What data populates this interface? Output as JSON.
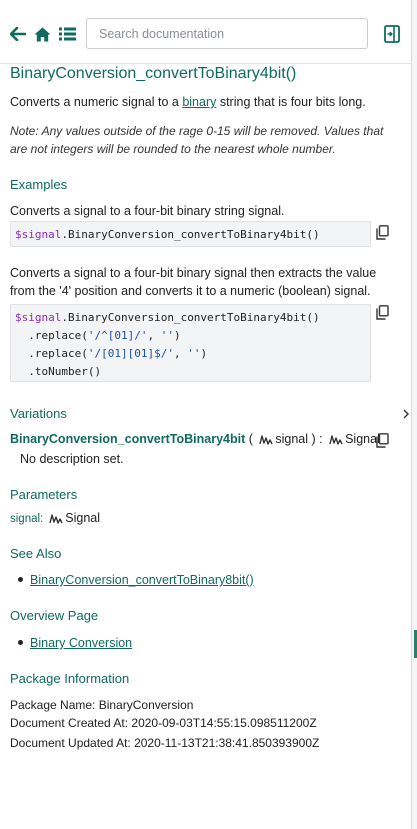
{
  "search": {
    "placeholder": "Search documentation"
  },
  "toolbar_icons": [
    "back-arrow-icon",
    "home-icon",
    "list-icon",
    "panel-toggle-icon"
  ],
  "doc": {
    "title": "BinaryConversion_convertToBinary4bit()",
    "description_before": "Converts a numeric signal to a ",
    "description_link": "binary",
    "description_after": " string that is four bits long.",
    "note": "Note: Any values outside of the rage 0-15 will be removed. Values that are not integers will be rounded to the nearest whole number."
  },
  "examples": {
    "heading": "Examples",
    "items": [
      {
        "description": "Converts a signal to a four-bit binary string signal.",
        "code_var": "$signal",
        "code_rest": ".BinaryConversion_convertToBinary4bit()"
      },
      {
        "description": "Converts a signal to a four-bit binary signal then extracts the value from the '4' position and converts it to a numeric (boolean) signal.",
        "code_var": "$signal",
        "code_line1": ".BinaryConversion_convertToBinary4bit()",
        "code_line2_pre": "  .replace(",
        "code_line2_str1": "'/^[01]/'",
        "code_line2_mid": ", ",
        "code_line2_str2": "''",
        "code_line2_post": ")",
        "code_line3_pre": "  .replace(",
        "code_line3_str1": "'/[01][01]$/'",
        "code_line3_mid": ", ",
        "code_line3_str2": "''",
        "code_line3_post": ")",
        "code_line4": "  .toNumber()"
      }
    ]
  },
  "variations": {
    "heading": "Variations",
    "function_name": "BinaryConversion_convertToBinary4bit",
    "open_paren": " ( ",
    "arg_type": "signal",
    "close_paren": " ) : ",
    "return_type": "Signal",
    "no_description": "No description set."
  },
  "parameters": {
    "heading": "Parameters",
    "name": "signal:",
    "type": "Signal"
  },
  "see_also": {
    "heading": "See Also",
    "link": "BinaryConversion_convertToBinary8bit()"
  },
  "overview": {
    "heading": "Overview Page",
    "link": "Binary Conversion"
  },
  "package": {
    "heading": "Package Information",
    "name_line": "Package Name: BinaryConversion",
    "created_line": "Document Created At: 2020-09-03T14:55:15.098511200Z",
    "updated_line": "Document Updated At: 2020-11-13T21:38:41.850393900Z"
  },
  "colors": {
    "accent": "#0e6b5e",
    "code_bg": "#f3f4f5",
    "var": "#8a2bbf",
    "string": "#1d4fa8"
  }
}
